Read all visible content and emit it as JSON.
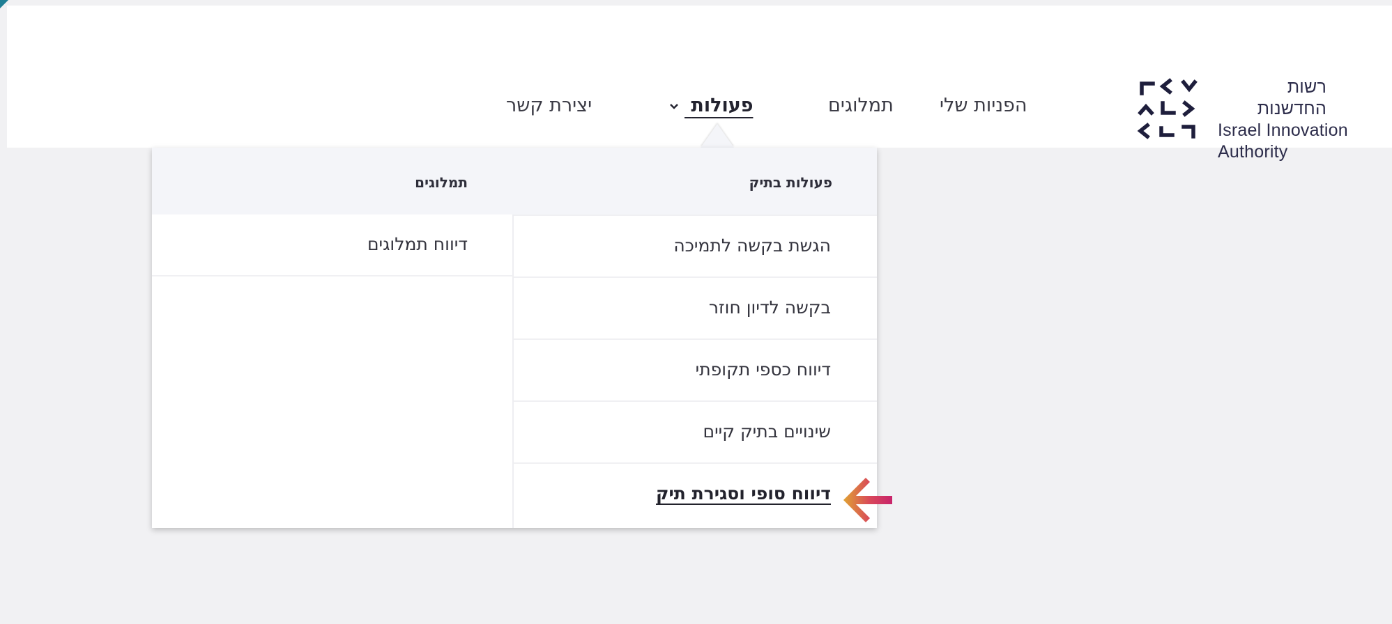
{
  "logo": {
    "hebrew_name": "רשות החדשנות",
    "english_line1": "Israel Innovation",
    "english_line2": "Authority",
    "color": "#2c2c4a"
  },
  "nav": {
    "my_applications": "הפניות שלי",
    "royalties": "תמלוגים",
    "actions": "פעולות",
    "contact": "יצירת קשר"
  },
  "menu": {
    "column_file_actions": "פעולות בתיק",
    "column_royalties": "תמלוגים",
    "file_actions": [
      "הגשת בקשה לתמיכה",
      "בקשה לדיון חוזר",
      "דיווח כספי תקופתי",
      "שינויים בתיק קיים",
      "דיווח סופי וסגירת תיק"
    ],
    "royalties_items": [
      "דיווח תמלוגים"
    ],
    "highlighted_item": "דיווח סופי וסגירת תיק"
  },
  "icons": {
    "logo": "israel-innovation-authority-logo-icon",
    "dropdown": "chevron-down-icon",
    "pointer": "arrow-left-icon"
  },
  "colors": {
    "accent_arrow_start": "#e0a233",
    "accent_arrow_end": "#c8246b",
    "corner": "#1f7f95"
  }
}
